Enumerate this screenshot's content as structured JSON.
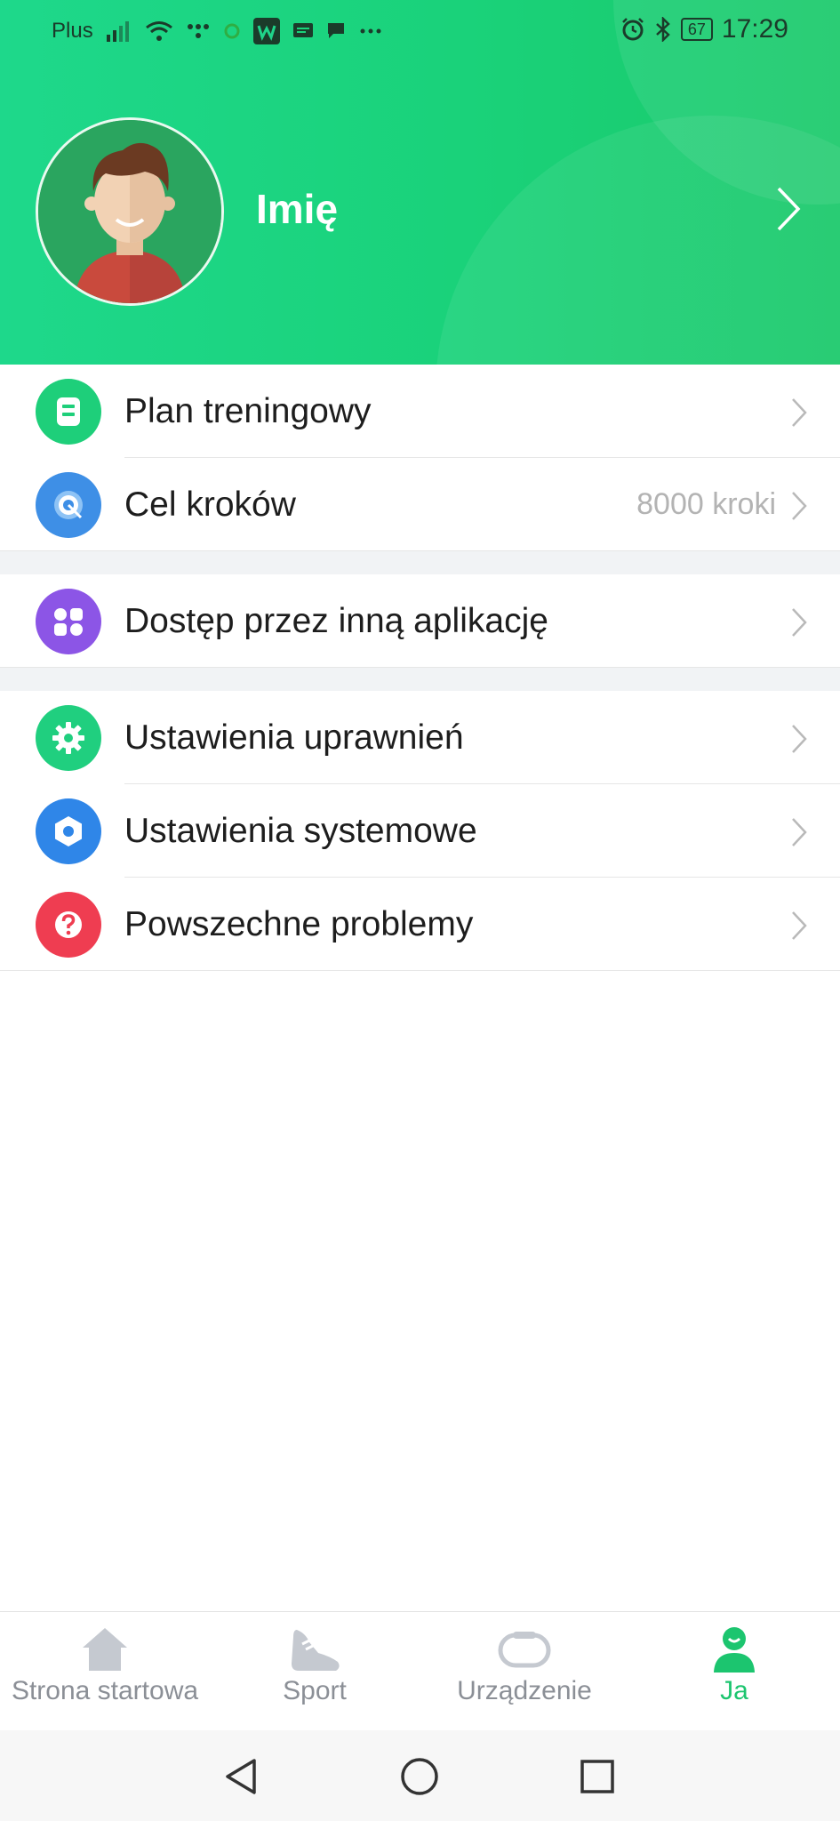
{
  "status_bar": {
    "carrier": "Plus",
    "battery": "67",
    "time": "17:29"
  },
  "profile": {
    "name": "Imię"
  },
  "menu": {
    "groups": [
      {
        "items": [
          {
            "label": "Plan treningowy",
            "value": "",
            "icon": "training-plan-icon",
            "color": "#1ecf7a"
          },
          {
            "label": "Cel kroków",
            "value": "8000 kroki",
            "icon": "step-goal-icon",
            "color": "#3e8fe6"
          }
        ]
      },
      {
        "items": [
          {
            "label": "Dostęp przez inną aplikację",
            "value": "",
            "icon": "apps-icon",
            "color": "#8c55e6"
          }
        ]
      },
      {
        "items": [
          {
            "label": "Ustawienia uprawnień",
            "value": "",
            "icon": "permission-gear-icon",
            "color": "#20cf7f"
          },
          {
            "label": "Ustawienia systemowe",
            "value": "",
            "icon": "system-gear-icon",
            "color": "#2f86e8"
          },
          {
            "label": "Powszechne problemy",
            "value": "",
            "icon": "help-icon",
            "color": "#ef3d51"
          }
        ]
      }
    ]
  },
  "bottom_nav": {
    "tabs": [
      {
        "label": "Strona startowa",
        "icon": "home-icon"
      },
      {
        "label": "Sport",
        "icon": "shoe-icon"
      },
      {
        "label": "Urządzenie",
        "icon": "band-icon"
      },
      {
        "label": "Ja",
        "icon": "person-icon",
        "active": true
      }
    ]
  },
  "colors": {
    "header_green": "#1ad27a",
    "accent": "#1cc56f",
    "muted": "#b3b3b3"
  }
}
